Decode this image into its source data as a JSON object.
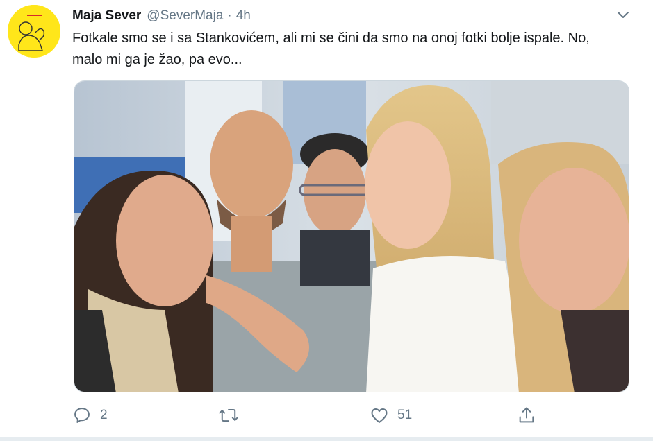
{
  "tweet": {
    "author_name": "Maja Sever",
    "handle": "@SeverMaja",
    "separator": "·",
    "time": "4h",
    "text": "Fotkale smo se i sa Stankovićem, ali mi se čini da smo na onoj fotki bolje ispale. No, malo mi ga je žao, pa evo...",
    "avatar_icon": "yellow-poster-avatar",
    "media_icon": "group-selfie-photo"
  },
  "actions": {
    "reply": {
      "icon": "reply-icon",
      "count": "2"
    },
    "retweet": {
      "icon": "retweet-icon",
      "count": ""
    },
    "like": {
      "icon": "heart-icon",
      "count": "51"
    },
    "share": {
      "icon": "share-icon",
      "count": ""
    }
  },
  "colors": {
    "text_primary": "#14171a",
    "text_secondary": "#657786",
    "avatar_bg": "#ffe61a",
    "divider": "#e6ecf0"
  }
}
